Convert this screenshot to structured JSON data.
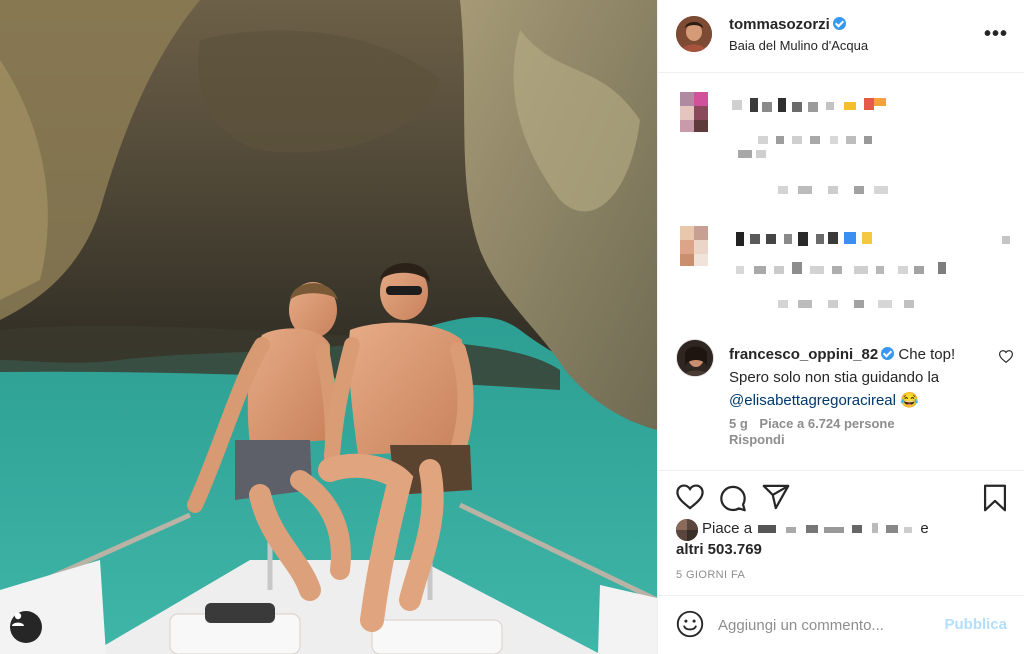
{
  "post": {
    "username": "tommasozorzi",
    "location": "Baia del Mulino d'Acqua",
    "more_label": "•••"
  },
  "comment": {
    "username": "francesco_oppini_82",
    "text_line": "Che top! Spero solo non stia guidando la",
    "mention": "@elisabettagregoracireal",
    "emoji": "😂",
    "age": "5 g",
    "likes": "Piace a 6.724 persone",
    "reply": "Rispondi"
  },
  "likes": {
    "prefix": "Piace a",
    "suffix": "e",
    "others": "altri 503.769"
  },
  "date": "5 GIORNI FA",
  "add_comment": {
    "placeholder": "Aggiungi un commento...",
    "publish": "Pubblica"
  },
  "icons": {
    "more": "more-options-icon",
    "verified": "verified-badge-icon",
    "heart": "heart-icon",
    "comment": "comment-icon",
    "share": "share-icon",
    "save": "bookmark-icon",
    "emoji": "emoji-icon",
    "user_tag": "user-tag-icon"
  },
  "colors": {
    "verified": "#3897f0",
    "mention": "#00376b",
    "muted": "#8e8e8e",
    "publish_disabled": "#b2dffc"
  }
}
